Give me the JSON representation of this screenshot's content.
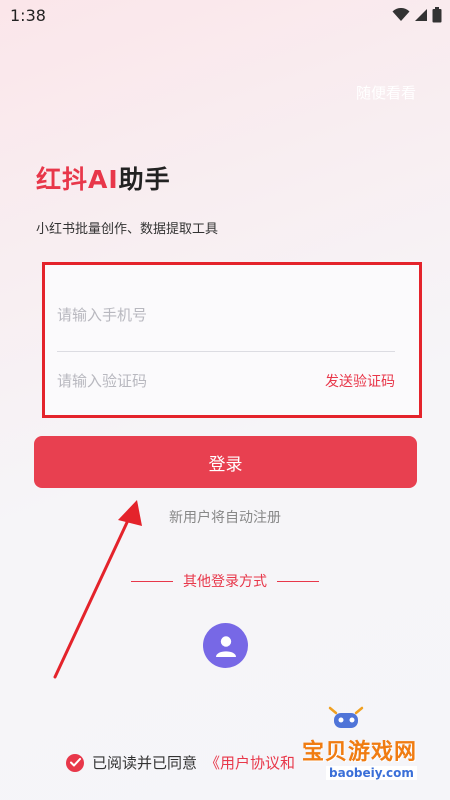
{
  "status_bar": {
    "time": "1:38"
  },
  "header": {
    "browse_label": "随便看看"
  },
  "brand": {
    "prefix": "红抖AI",
    "suffix": "助手",
    "subtitle": "小红书批量创作、数据提取工具"
  },
  "form": {
    "phone_placeholder": "请输入手机号",
    "code_placeholder": "请输入验证码",
    "send_code_label": "发送验证码"
  },
  "login_button": "登录",
  "auto_register_note": "新用户将自动注册",
  "other_login": {
    "label": "其他登录方式"
  },
  "agreement": {
    "prefix": "已阅读并已同意",
    "link": "《用户协议和"
  },
  "watermark": {
    "name": "宝贝游戏网",
    "domain": "baobeiy.com"
  },
  "colors": {
    "accent": "#e8374a",
    "highlight_box": "#e4232b",
    "avatar": "#7768e6",
    "watermark": "#f07c12"
  }
}
